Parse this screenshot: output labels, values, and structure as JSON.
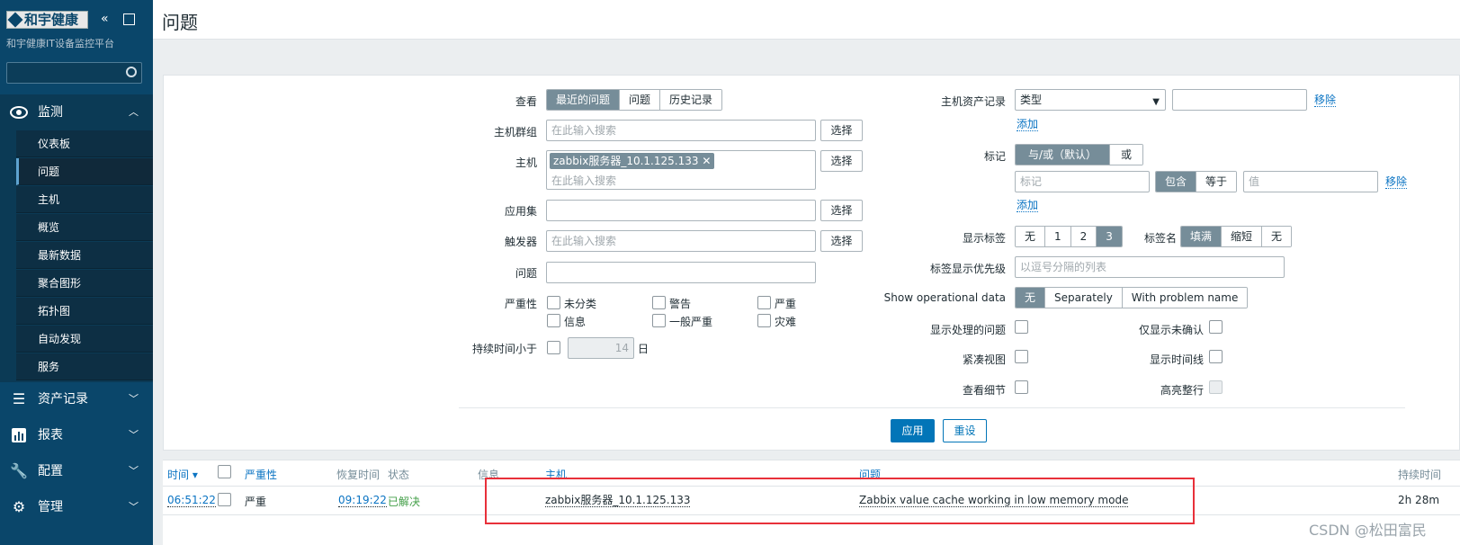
{
  "sidebar": {
    "logo": "和宇健康",
    "subtitle": "和宇健康IT设备监控平台",
    "collapse_icon": "«",
    "fullscreen_icon": "⛶",
    "search_value": "",
    "monitoring": {
      "label": "监测",
      "icon": "eye-icon"
    },
    "sub_items": [
      "仪表板",
      "问题",
      "主机",
      "概览",
      "最新数据",
      "聚合图形",
      "拓扑图",
      "自动发现",
      "服务"
    ],
    "selected_item": "问题",
    "menus": [
      {
        "label": "资产记录",
        "icon": "list-icon"
      },
      {
        "label": "报表",
        "icon": "bar-chart-icon"
      },
      {
        "label": "配置",
        "icon": "wrench-icon"
      },
      {
        "label": "管理",
        "icon": "gear-icon"
      }
    ]
  },
  "header": {
    "title": "问题"
  },
  "filter": {
    "view_label": "查看",
    "view_options": [
      "最近的问题",
      "问题",
      "历史记录"
    ],
    "view_selected": "最近的问题",
    "host_group_label": "主机群组",
    "host_label": "主机",
    "host_chip": "zabbix服务器_10.1.125.133",
    "application_label": "应用集",
    "trigger_label": "触发器",
    "problem_label": "问题",
    "search_placeholder": "在此输入搜索",
    "select_button": "选择",
    "severity_label": "严重性",
    "severities": [
      "未分类",
      "警告",
      "严重",
      "信息",
      "一般严重",
      "灾难"
    ],
    "age_label": "持续时间小于",
    "age_value": "14",
    "age_unit": "日",
    "inventory_label": "主机资产记录",
    "inventory_field": "类型",
    "inventory_value": "",
    "remove_link": "移除",
    "add_link": "添加",
    "tags_label": "标记",
    "tag_operator": [
      "与/或（默认）",
      "或"
    ],
    "tag_name_placeholder": "标记",
    "tag_match": [
      "包含",
      "等于"
    ],
    "tag_value_placeholder": "值",
    "show_tags_label": "显示标签",
    "show_tags_options": [
      "无",
      "1",
      "2",
      "3"
    ],
    "show_tags_selected": "3",
    "tag_name_label": "标签名",
    "tag_name_options": [
      "填满",
      "缩短",
      "无"
    ],
    "tag_priority_label": "标签显示优先级",
    "tag_priority_placeholder": "以逗号分隔的列表",
    "opdata_label": "Show operational data",
    "opdata_options": [
      "无",
      "Separately",
      "With problem name"
    ],
    "show_suppressed_label": "显示处理的问题",
    "unack_only_label": "仅显示未确认",
    "compact_view_label": "紧凑视图",
    "show_timeline_label": "显示时间线",
    "details_label": "查看细节",
    "highlight_label": "高亮整行",
    "apply_button": "应用",
    "reset_button": "重设"
  },
  "table": {
    "headers": {
      "time": "时间 ▾",
      "severity": "严重性",
      "recovery": "恢复时间",
      "status": "状态",
      "info": "信息",
      "host": "主机",
      "problem": "问题",
      "duration": "持续时间"
    },
    "rows": [
      {
        "time": "06:51:22",
        "severity": "严重",
        "recovery": "09:19:22",
        "status": "已解决",
        "host": "zabbix服务器_10.1.125.133",
        "problem": "Zabbix value cache working in low memory mode",
        "duration": "2h 28m"
      }
    ]
  },
  "watermark": "CSDN @松田富民",
  "colors": {
    "sidebar": "#0a466a",
    "accent": "#0275b8",
    "resolved": "#429e47",
    "highlight_box": "#e8303a"
  }
}
